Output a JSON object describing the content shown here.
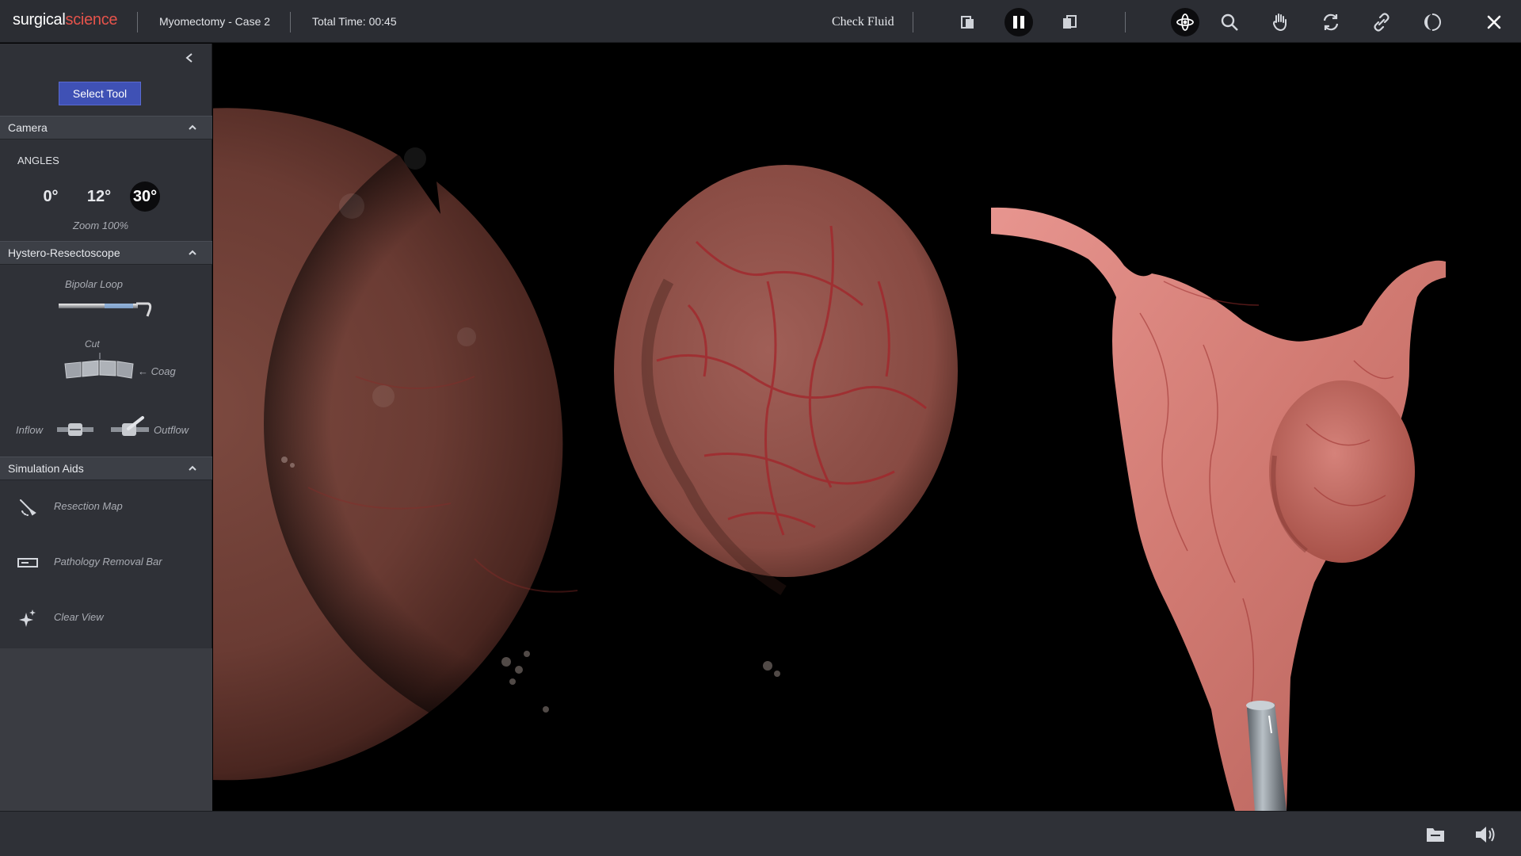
{
  "header": {
    "brand_part1": "surgical",
    "brand_part2": "science",
    "case_title": "Myomectomy - Case 2",
    "total_time": "Total Time: 00:45",
    "check_fluid": "Check Fluid",
    "icons": [
      "panel-left-icon",
      "pause-icon",
      "panel-right-icon",
      "rotate-view-icon",
      "zoom-icon",
      "hand-icon",
      "refresh-icon",
      "link-icon",
      "contrast-icon",
      "close-icon"
    ]
  },
  "sidebar": {
    "select_tool": "Select Tool",
    "camera": {
      "title": "Camera",
      "angles_label": "ANGLES",
      "angles": [
        "0°",
        "12°",
        "30°"
      ],
      "active_angle": "30°",
      "zoom": "Zoom 100%"
    },
    "hystero": {
      "title": "Hystero-Resectoscope",
      "tool": "Bipolar Loop",
      "cut": "Cut",
      "coag": "Coag",
      "inflow": "Inflow",
      "outflow": "Outflow"
    },
    "aids": {
      "title": "Simulation Aids",
      "items": [
        "Resection Map",
        "Pathology Removal Bar",
        "Clear View"
      ]
    }
  },
  "colors": {
    "accent": "#3f51b5",
    "brand_red": "#e5534b",
    "panel": "#2f3137"
  }
}
